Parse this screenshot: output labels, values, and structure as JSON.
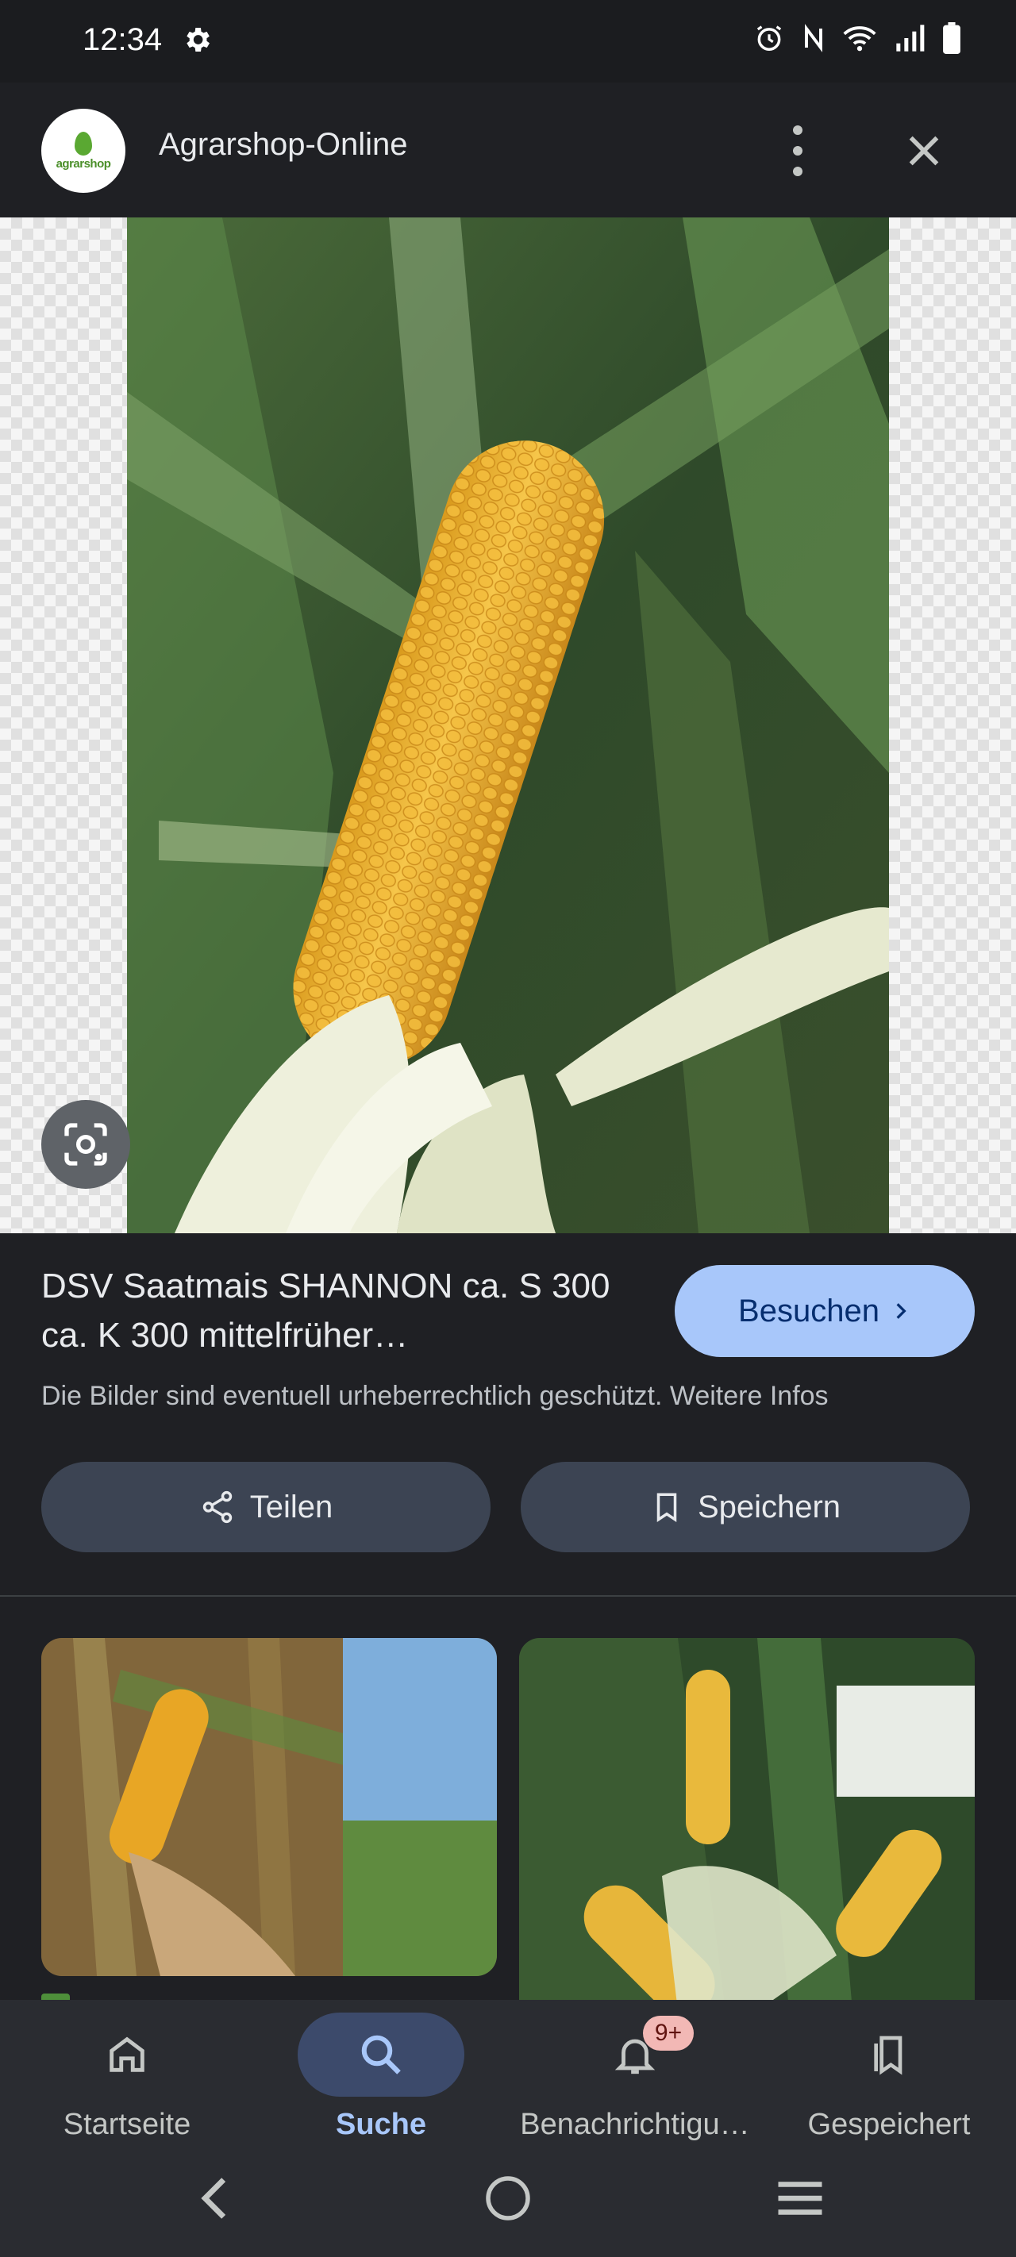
{
  "status_bar": {
    "time": "12:34",
    "icons": [
      "settings-gear-icon",
      "alarm-icon",
      "nfc-icon",
      "wifi-icon",
      "signal-icon",
      "battery-icon"
    ]
  },
  "header": {
    "logo_text": "agrarshop",
    "site_name": "Agrarshop-Online",
    "icons": [
      "more-vert-icon",
      "close-icon"
    ]
  },
  "image_viewer": {
    "lens_icon": "google-lens-icon"
  },
  "result": {
    "title": "DSV Saatmais SHANNON ca. S 300 ca. K 300 mittelfrüher…",
    "visit_label": "Besuchen",
    "copyright_notice": "Die Bilder sind eventuell urheberrechtlich geschützt. Weitere Infos",
    "share_label": "Teilen",
    "save_label": "Speichern"
  },
  "bottom_nav": {
    "items": [
      {
        "label": "Startseite",
        "icon": "home-icon",
        "active": false
      },
      {
        "label": "Suche",
        "icon": "search-icon",
        "active": true
      },
      {
        "label": "Benachrichtigu…",
        "icon": "bell-icon",
        "active": false,
        "badge": "9+"
      },
      {
        "label": "Gespeichert",
        "icon": "collections-icon",
        "active": false
      }
    ]
  },
  "system_nav": [
    "back-icon",
    "home-circle-icon",
    "recents-icon"
  ],
  "colors": {
    "background": "#1f2024",
    "accent": "#a8c7fa",
    "pill": "#3c4453",
    "badge": "#f2b8b5"
  }
}
